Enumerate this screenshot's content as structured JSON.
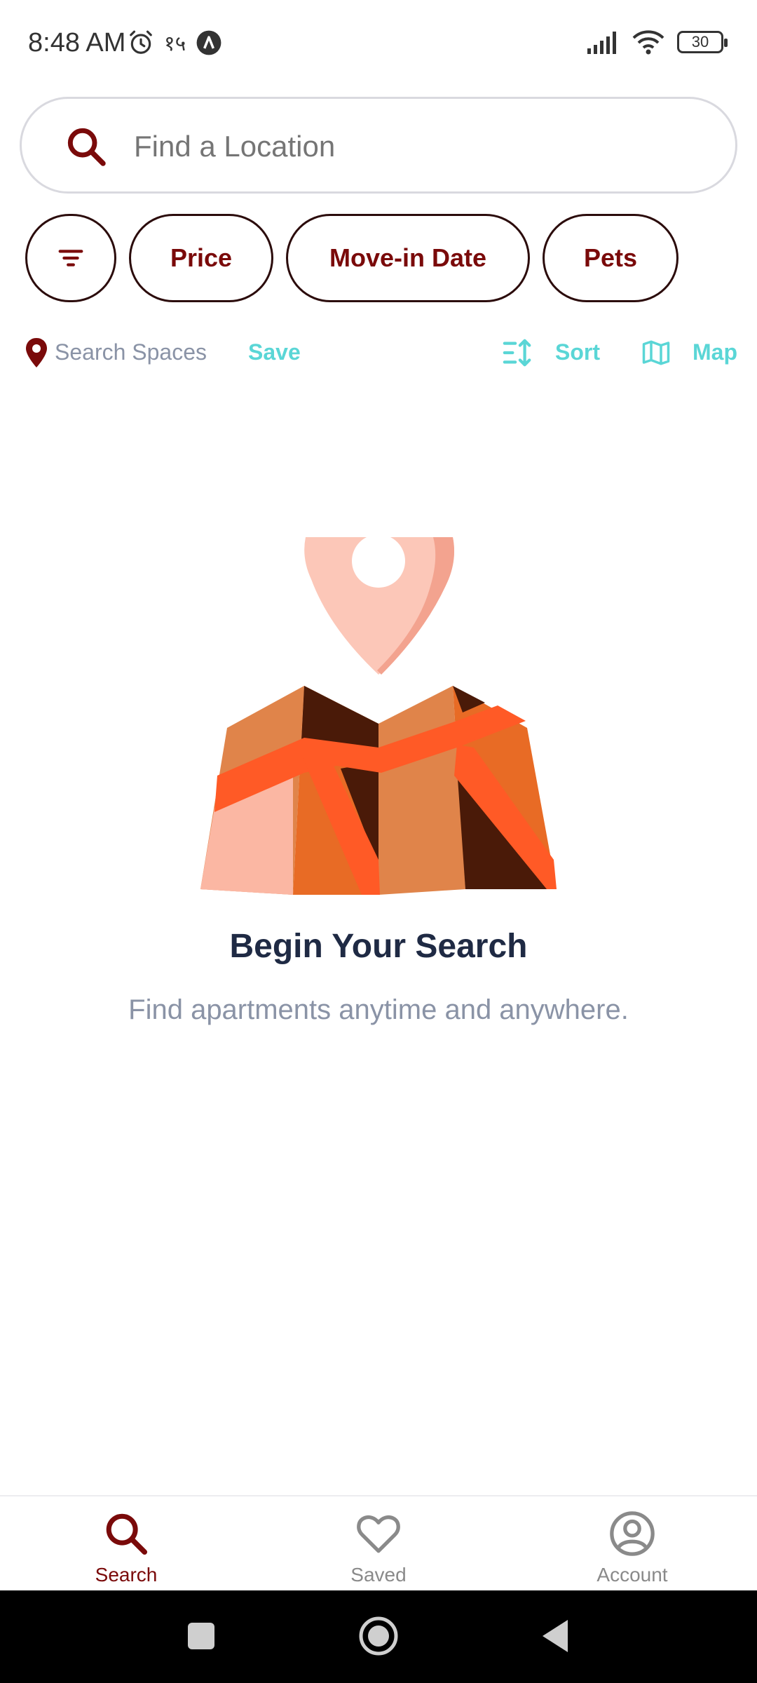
{
  "status_bar": {
    "time": "8:48 AM",
    "extra_text": "१५",
    "battery": "30",
    "icons": [
      "alarm-icon",
      "a-badge-icon",
      "signal-icon",
      "wifi-icon",
      "battery-icon"
    ]
  },
  "search": {
    "placeholder": "Find a Location",
    "value": ""
  },
  "filters": {
    "price": "Price",
    "move_in": "Move-in Date",
    "pets": "Pets"
  },
  "toolbar": {
    "search_spaces": "Search Spaces",
    "save": "Save",
    "sort": "Sort",
    "map": "Map"
  },
  "empty_state": {
    "title": "Begin Your Search",
    "subtitle": "Find apartments anytime and anywhere."
  },
  "bottom_nav": {
    "items": [
      {
        "label": "Search",
        "icon": "search-icon",
        "active": true
      },
      {
        "label": "Saved",
        "icon": "heart-icon",
        "active": false
      },
      {
        "label": "Account",
        "icon": "account-icon",
        "active": false
      }
    ]
  },
  "colors": {
    "brand": "#7a0a0a",
    "accent": "#5ad6d6",
    "muted": "#8a93a6",
    "heading": "#1f2a44"
  }
}
